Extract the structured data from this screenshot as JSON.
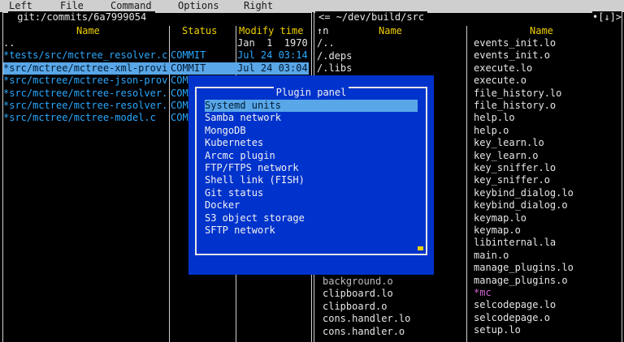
{
  "menubar": {
    "items": [
      "Left",
      "File",
      "Command",
      "Options",
      "Right"
    ]
  },
  "left_panel": {
    "title": " git:/commits/6a7999054 ",
    "headers": {
      "name": "Name",
      "status": "Status",
      "mtime": "Modify time"
    },
    "rows": [
      {
        "name": "..",
        "status": "",
        "mtime": "Jan  1  1970",
        "style": "normal"
      },
      {
        "name": "*tests/src/mctree_resolver.c",
        "status": "COMMIT",
        "mtime": "Jul 24 03:14",
        "style": "cyan"
      },
      {
        "name": "*src/mctree/mctree-xml-provid",
        "status": "COMMIT",
        "mtime": "Jul 24 03:04",
        "style": "selected"
      },
      {
        "name": "*src/mctree/mctree-json-provi",
        "status": "COM",
        "mtime": "",
        "style": "cyan"
      },
      {
        "name": "*src/mctree/mctree-resolver.c",
        "status": "COM",
        "mtime": "",
        "style": "cyan"
      },
      {
        "name": "*src/mctree/mctree-resolver.h",
        "status": "COM",
        "mtime": "",
        "style": "cyan"
      },
      {
        "name": "*src/mctree/mctree-model.c",
        "status": "COM",
        "mtime": "",
        "style": "cyan"
      }
    ]
  },
  "right_panel": {
    "title": "<= ~/dev/build/src",
    "corner": "•[↓]>",
    "headers": {
      "col1": "Name",
      "col2": "Name"
    },
    "col1_top": [
      {
        "name": "↑n",
        "style": "normal"
      },
      {
        "name": "/..",
        "style": "normal"
      },
      {
        "name": "/.deps",
        "style": "normal"
      },
      {
        "name": "/.libs",
        "style": "normal"
      }
    ],
    "col1_bottom": [
      {
        "name": "background.o",
        "style": "dim"
      },
      {
        "name": "clipboard.lo",
        "style": "normal"
      },
      {
        "name": "clipboard.o",
        "style": "normal"
      },
      {
        "name": "cons.handler.lo",
        "style": "normal"
      },
      {
        "name": "cons.handler.o",
        "style": "normal"
      }
    ],
    "col2": [
      {
        "name": "events_init.lo",
        "style": "normal"
      },
      {
        "name": "events_init.o",
        "style": "normal"
      },
      {
        "name": "execute.lo",
        "style": "normal"
      },
      {
        "name": "execute.o",
        "style": "normal"
      },
      {
        "name": "file_history.lo",
        "style": "normal"
      },
      {
        "name": "file_history.o",
        "style": "normal"
      },
      {
        "name": "help.lo",
        "style": "normal"
      },
      {
        "name": "help.o",
        "style": "normal"
      },
      {
        "name": "key_learn.lo",
        "style": "normal"
      },
      {
        "name": "key_learn.o",
        "style": "normal"
      },
      {
        "name": "key_sniffer.lo",
        "style": "normal"
      },
      {
        "name": "key_sniffer.o",
        "style": "normal"
      },
      {
        "name": "keybind_dialog.lo",
        "style": "normal"
      },
      {
        "name": "keybind_dialog.o",
        "style": "normal"
      },
      {
        "name": "keymap.lo",
        "style": "normal"
      },
      {
        "name": "keymap.o",
        "style": "normal"
      },
      {
        "name": "libinternal.la",
        "style": "normal"
      },
      {
        "name": "main.o",
        "style": "normal"
      },
      {
        "name": "manage_plugins.lo",
        "style": "normal"
      },
      {
        "name": "manage_plugins.o",
        "style": "normal"
      },
      {
        "name": "*mc",
        "style": "magenta"
      },
      {
        "name": "selcodepage.lo",
        "style": "normal"
      },
      {
        "name": "selcodepage.o",
        "style": "normal"
      },
      {
        "name": "setup.lo",
        "style": "normal"
      }
    ]
  },
  "plugin_panel": {
    "title": "Plugin panel",
    "items": [
      "Systemd units",
      "Samba network",
      "MongoDB",
      "Kubernetes",
      "Arcmc plugin",
      "FTP/FTPS network",
      "Shell link (FISH)",
      "Git status",
      "Docker",
      "S3 object storage",
      "SFTP network"
    ],
    "selected_index": 0
  },
  "colors": {
    "menubar_bg": "#cfcfcf",
    "header_yellow": "#f0d000",
    "file_cyan": "#2aa8ff",
    "selection": "#59a7e8",
    "dialog_blue": "#0033cc",
    "exec_magenta": "#d066d0"
  }
}
